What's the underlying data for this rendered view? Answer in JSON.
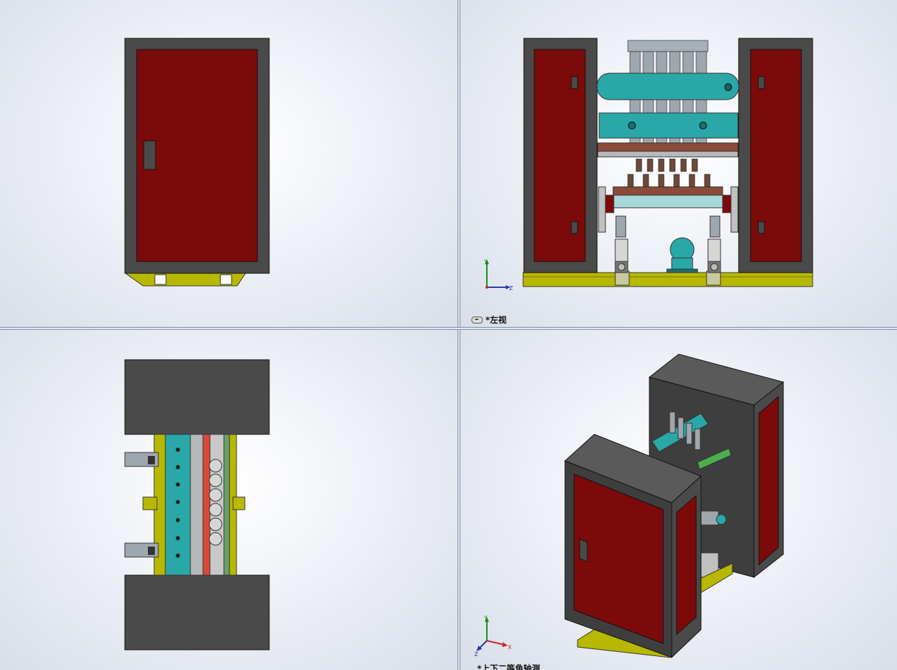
{
  "viewports": {
    "top_left": {
      "label": ""
    },
    "top_right": {
      "label": "*左视",
      "triad": {
        "axes": [
          "Y",
          "Z"
        ]
      }
    },
    "bottom_left": {
      "label": ""
    },
    "bottom_right": {
      "label": "*上下二等角轴测",
      "triad": {
        "axes": [
          "Y",
          "X",
          "Z"
        ]
      }
    }
  },
  "colors": {
    "cabinet_body": "#4a4a4a",
    "cabinet_door": "#7d0a0a",
    "base_frame": "#b8b800",
    "cylinder_teal": "#2aa7a7",
    "steel_gray": "#9ea7ad",
    "brown_rail": "#8b4a3a",
    "background_center": "#ffffff",
    "background_edge": "#d9dee8",
    "splitter": "#7d8aa8"
  }
}
